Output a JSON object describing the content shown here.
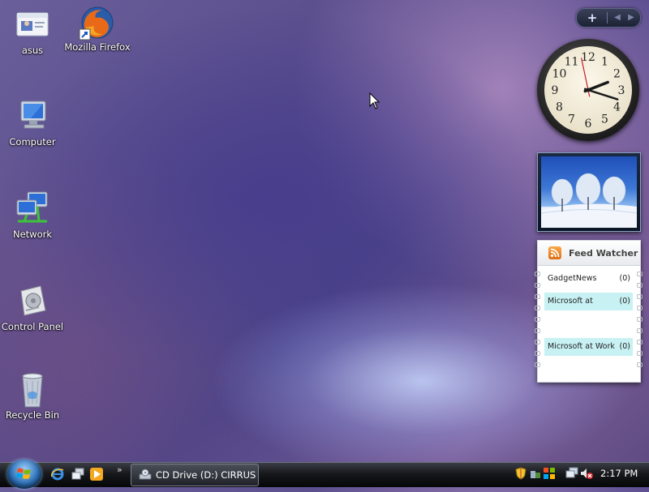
{
  "desktop": {
    "icons": [
      {
        "label": "asus",
        "icon": "user-folder-icon"
      },
      {
        "label": "Mozilla Firefox",
        "icon": "firefox-icon"
      },
      {
        "label": "Computer",
        "icon": "computer-icon"
      },
      {
        "label": "Network",
        "icon": "network-icon"
      },
      {
        "label": "Control Panel",
        "icon": "control-panel-icon"
      },
      {
        "label": "Recycle Bin",
        "icon": "recycle-bin-icon"
      }
    ]
  },
  "sidebar": {
    "add_label": "+",
    "prev_label": "◀",
    "next_label": "▶",
    "clock": {
      "numerals": [
        "12",
        "1",
        "2",
        "3",
        "4",
        "5",
        "6",
        "7",
        "8",
        "9",
        "10",
        "11"
      ],
      "hour": 2,
      "minute": 17,
      "second": 58
    },
    "feed_watcher": {
      "title": "Feed Watcher",
      "feeds": [
        {
          "name": "GadgetNews",
          "count": "(0)"
        },
        {
          "name": "Microsoft at",
          "count": "(0)"
        },
        {
          "name": "",
          "count": ""
        },
        {
          "name": "Microsoft at Work",
          "count": "(0)"
        }
      ]
    }
  },
  "taskbar": {
    "chevron": "»",
    "task_button": "CD Drive (D:) CIRRUS",
    "clock": "2:17 PM"
  },
  "colors": {
    "feed_highlight": "#c8f1f3",
    "taskbar": "#16181c",
    "clock_second_hand": "#d0182a"
  }
}
